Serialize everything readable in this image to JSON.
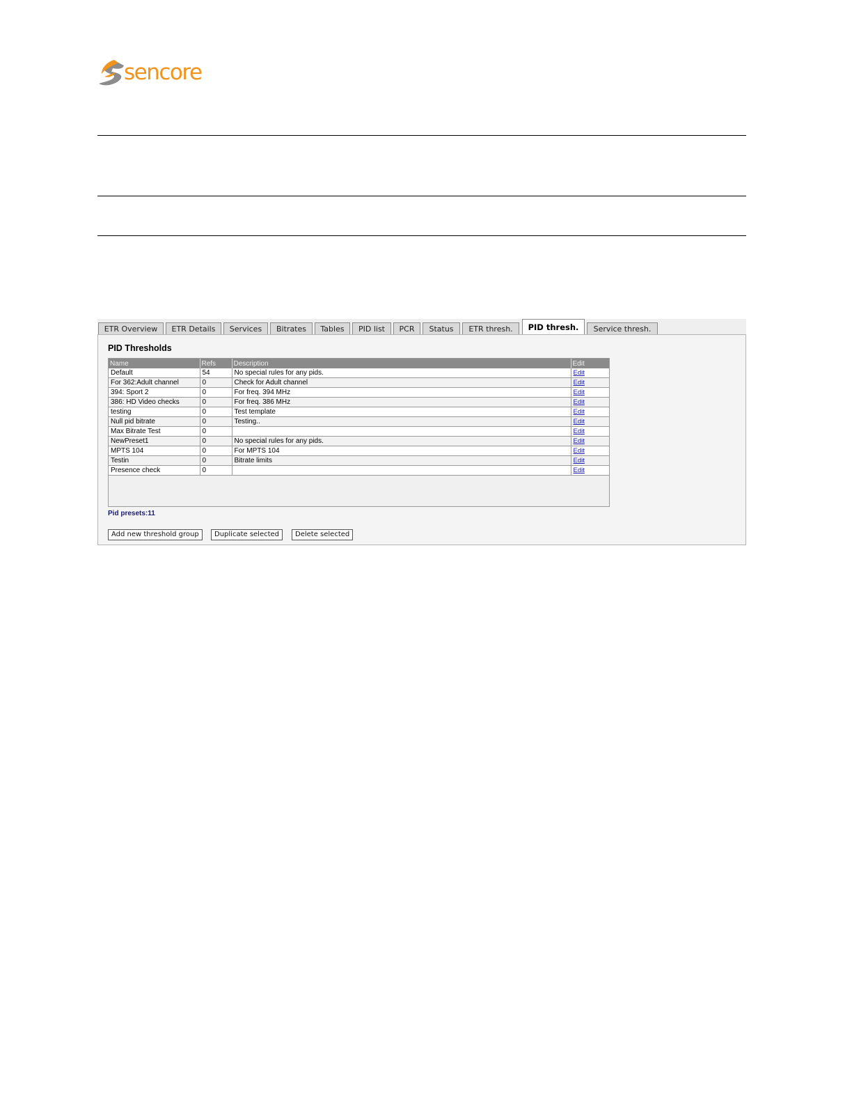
{
  "logo": {
    "text": "sencore",
    "accent_color": "#f0941e",
    "mark_color": "#8c8c8c"
  },
  "tabs": [
    {
      "label": "ETR Overview",
      "active": false
    },
    {
      "label": "ETR Details",
      "active": false
    },
    {
      "label": "Services",
      "active": false
    },
    {
      "label": "Bitrates",
      "active": false
    },
    {
      "label": "Tables",
      "active": false
    },
    {
      "label": "PID list",
      "active": false
    },
    {
      "label": "PCR",
      "active": false
    },
    {
      "label": "Status",
      "active": false
    },
    {
      "label": "ETR thresh.",
      "active": false
    },
    {
      "label": "PID thresh.",
      "active": true
    },
    {
      "label": "Service thresh.",
      "active": false
    }
  ],
  "panel": {
    "title": "PID Thresholds",
    "columns": [
      "Name",
      "Refs",
      "Description",
      "Edit"
    ],
    "rows": [
      {
        "name": "Default",
        "refs": "54",
        "description": "No special rules for any pids.",
        "edit": "Edit"
      },
      {
        "name": "For 362:Adult channel",
        "refs": "0",
        "description": "Check for Adult channel",
        "edit": "Edit"
      },
      {
        "name": "394: Sport 2",
        "refs": "0",
        "description": "For freq. 394 MHz",
        "edit": "Edit"
      },
      {
        "name": "386: HD Video checks",
        "refs": "0",
        "description": "For freq. 386 MHz",
        "edit": "Edit"
      },
      {
        "name": "testing",
        "refs": "0",
        "description": "Test template",
        "edit": "Edit"
      },
      {
        "name": "Null pid bitrate",
        "refs": "0",
        "description": "Testing..",
        "edit": "Edit"
      },
      {
        "name": "Max Bitrate Test",
        "refs": "0",
        "description": "",
        "edit": "Edit"
      },
      {
        "name": "NewPreset1",
        "refs": "0",
        "description": "No special rules for any pids.",
        "edit": "Edit"
      },
      {
        "name": "MPTS 104",
        "refs": "0",
        "description": "For MPTS 104",
        "edit": "Edit"
      },
      {
        "name": "Testin",
        "refs": "0",
        "description": "Bitrate limits",
        "edit": "Edit"
      },
      {
        "name": "Presence check",
        "refs": "0",
        "description": "",
        "edit": "Edit"
      }
    ],
    "count_label": "Pid presets:11",
    "buttons": {
      "add": "Add new threshold group",
      "duplicate": "Duplicate selected",
      "delete": "Delete selected"
    }
  }
}
